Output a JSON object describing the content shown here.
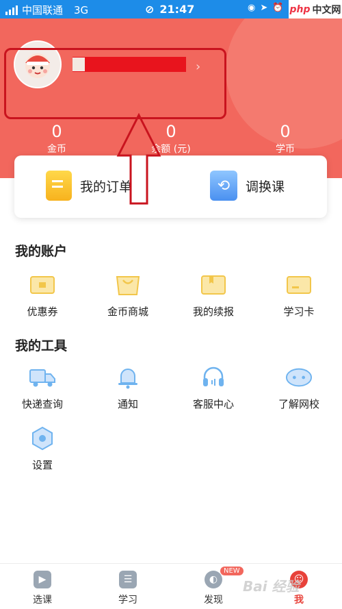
{
  "status_bar": {
    "carrier": "中国联通",
    "network": "3G",
    "time": "21:47",
    "brand_badge": [
      "php",
      "中文网"
    ]
  },
  "profile": {
    "user_name_redacted": ""
  },
  "stats": [
    {
      "value": "0",
      "label": "金币"
    },
    {
      "value": "0",
      "label": "余额 (元)"
    },
    {
      "value": "0",
      "label": "学币"
    }
  ],
  "quick_card": {
    "orders_label": "我的订单",
    "swap_label": "调换课"
  },
  "account_section": {
    "title": "我的账户",
    "items": [
      {
        "label": "优惠券",
        "icon": "coupon-icon"
      },
      {
        "label": "金币商城",
        "icon": "shopping-bag-icon"
      },
      {
        "label": "我的续报",
        "icon": "renewal-icon"
      },
      {
        "label": "学习卡",
        "icon": "card-icon"
      }
    ]
  },
  "tools_section": {
    "title": "我的工具",
    "items": [
      {
        "label": "快递查询",
        "icon": "truck-icon"
      },
      {
        "label": "通知",
        "icon": "bell-icon"
      },
      {
        "label": "客服中心",
        "icon": "headset-icon"
      },
      {
        "label": "了解网校",
        "icon": "chat-cloud-icon"
      },
      {
        "label": "设置",
        "icon": "settings-hex-icon"
      }
    ]
  },
  "tab_bar": {
    "tabs": [
      {
        "label": "选课",
        "icon": "play-icon"
      },
      {
        "label": "学习",
        "icon": "list-icon"
      },
      {
        "label": "发现",
        "icon": "compass-icon"
      },
      {
        "label": "我",
        "icon": "mascot-icon"
      }
    ],
    "new_badge": "NEW",
    "active_index": 3
  },
  "colors": {
    "status_bar": "#1d8ce8",
    "header": "#f2675d",
    "annotation": "#c9131e",
    "redaction": "#e8141d",
    "icon_yellow": "#f7c948",
    "icon_blue": "#6fb3ef",
    "tab_active": "#e8423a"
  },
  "watermark": "Bai 经验"
}
